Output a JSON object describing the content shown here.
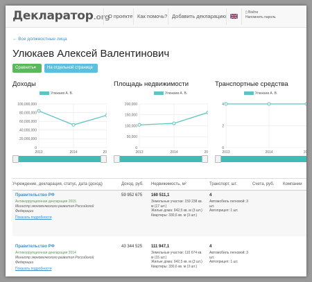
{
  "navbar": {
    "logo": "Декларатор",
    "logo_tld": ".org",
    "links": [
      "О проекте",
      "Как помочь?",
      "Добавить декларацию"
    ],
    "login_line1": "Войти",
    "login_line2": "Напомнить пароль",
    "flag_icon": "uk-flag-icon"
  },
  "back_link": "← Все должностные лица",
  "person_name": "Улюкаев Алексей Валентинович",
  "buttons": {
    "compare": "Сравнить▾",
    "separate_page": "На отдельной странице"
  },
  "colors": {
    "series": "#5cc4c4",
    "slider": "#3fbcb4",
    "link": "#3a8fce",
    "green_button": "#5cb85c",
    "blue_button": "#5bc0de"
  },
  "chart_data": [
    {
      "type": "line",
      "title": "Доходы",
      "x": [
        "2013",
        "2014",
        "2015"
      ],
      "series": [
        {
          "name": "Улюкаев А. В.",
          "values": [
            84000000,
            52000000,
            74000000
          ]
        }
      ],
      "yticks": [
        "0",
        "20,000,000",
        "40,000,000",
        "60,000,000",
        "80,000,000",
        "100,000,000"
      ],
      "ylim": [
        0,
        100000000
      ],
      "grid": true,
      "legend": "top"
    },
    {
      "type": "line",
      "title": "Площадь недвижимости",
      "x": [
        "2013",
        "2014",
        "2015"
      ],
      "series": [
        {
          "name": "Улюкаев А. В.",
          "values": [
            104000,
            111000,
            161000
          ]
        }
      ],
      "yticks": [
        "0",
        "50,000",
        "100,000",
        "150,000",
        "200,000"
      ],
      "ylim": [
        0,
        200000
      ],
      "grid": true,
      "legend": "top"
    },
    {
      "type": "line",
      "title": "Транспортные средства",
      "x": [
        "2013",
        "2014",
        "201"
      ],
      "series": [
        {
          "name": "Улюкаев А. В.",
          "values": [
            4,
            4,
            4
          ]
        }
      ],
      "yticks": [
        "0",
        "2",
        "4"
      ],
      "ylim": [
        0,
        4
      ],
      "grid": true,
      "legend": "top"
    }
  ],
  "table": {
    "headers": [
      "Учреждение, декларация, статус, дата (доход)",
      "Доход, руб.",
      "Недвижимость, м²",
      "Транспорт, шт.",
      "Счета, руб.",
      "Компании"
    ],
    "rows": [
      {
        "org": "Правительство РФ",
        "declaration": "Антикоррупционная декларация 2015",
        "ministry": "Министр экономического развития Российской Федерации",
        "details": "Показать подробности",
        "income": "59 952 675",
        "estate_total": "160 511,1",
        "estate_lines": [
          "Земельные участки: 159 238 кв. м (17 шт.)",
          "Жилые дома: 942,5 кв. м (3 шт.)",
          "Квартиры: 330,6 кв. м (3 шт.)"
        ],
        "transport_count": "4",
        "transport_lines": [
          "Автомобиль легковой: 3 шт.",
          "Автоприцеп: 1 шт."
        ]
      },
      {
        "org": "Правительство РФ",
        "declaration": "Антикоррупционная декларация 2014",
        "ministry": "Министр экономического развития Российской Федерации",
        "details": "Показать подробности",
        "income": "43 344 525",
        "estate_total": "111 947,1",
        "estate_lines": [
          "Земельные участки: 110 674 кв. м (15 шт.)",
          "Жилые дома: 942,5 кв. м (3 шт.)",
          "Квартиры: 330,6 кв. м (3 шт.)"
        ],
        "transport_count": "4",
        "transport_lines": [
          "Автомобиль легковой: 3 шт.",
          "Автоприцеп: 1 шт."
        ]
      }
    ]
  }
}
